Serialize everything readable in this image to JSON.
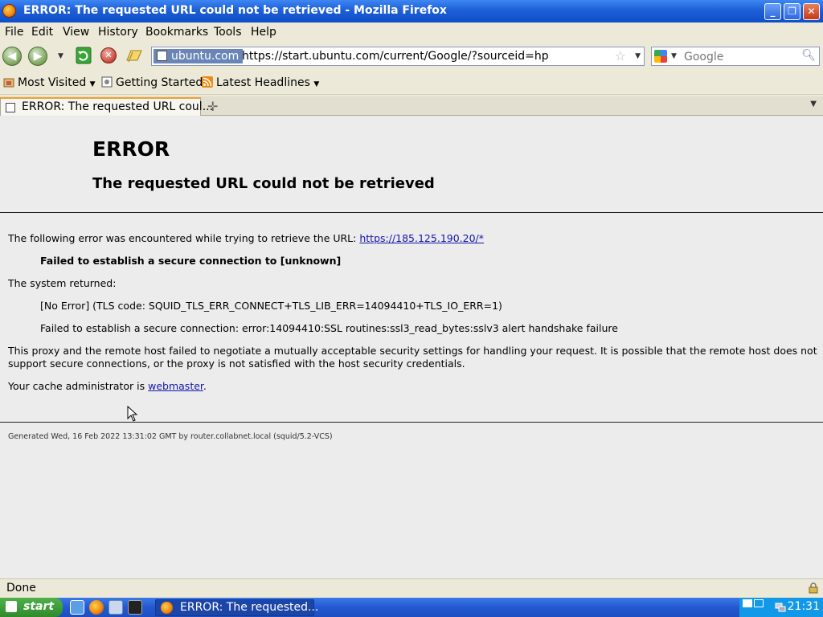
{
  "window": {
    "title": "ERROR: The requested URL could not be retrieved - Mozilla Firefox",
    "btn_minimize": "_",
    "btn_restore": "❐",
    "btn_close": "✕"
  },
  "menu": [
    "File",
    "Edit",
    "View",
    "History",
    "Bookmarks",
    "Tools",
    "Help"
  ],
  "nav": {
    "identity": "ubuntu.com",
    "url": "https://start.ubuntu.com/current/Google/?sourceid=hp",
    "search_placeholder": "Google"
  },
  "bookmarks": [
    "Most Visited",
    "Getting Started",
    "Latest Headlines"
  ],
  "tab": {
    "label": "ERROR: The requested URL coul..."
  },
  "page": {
    "h1": "ERROR",
    "h2": "The requested URL could not be retrieved",
    "intro": "The following error was encountered while trying to retrieve the URL: ",
    "intro_link": "https://185.125.190.20/*",
    "failed": "Failed to establish a secure connection to [unknown]",
    "system_returned": "The system returned:",
    "tls_code": "[No Error] (TLS code: SQUID_TLS_ERR_CONNECT+TLS_LIB_ERR=14094410+TLS_IO_ERR=1)",
    "ssl_error": "Failed to establish a secure connection: error:14094410:SSL routines:ssl3_read_bytes:sslv3 alert handshake failure",
    "explain_1": "This proxy and the remote host failed to negotiate a mutually acceptable security settings for handling your request. It is possible that the remote host does not",
    "explain_2": "support secure connections, or the proxy is not satisfied with the host security credentials.",
    "admin_prefix": "Your cache administrator is ",
    "admin_link": "webmaster",
    "admin_suffix": ".",
    "footer": "Generated Wed, 16 Feb 2022 13:31:02 GMT by router.collabnet.local (squid/5.2-VCS)"
  },
  "status": "Done",
  "taskbar": {
    "start": "start",
    "task": "ERROR: The requested...",
    "clock": "21:31"
  }
}
